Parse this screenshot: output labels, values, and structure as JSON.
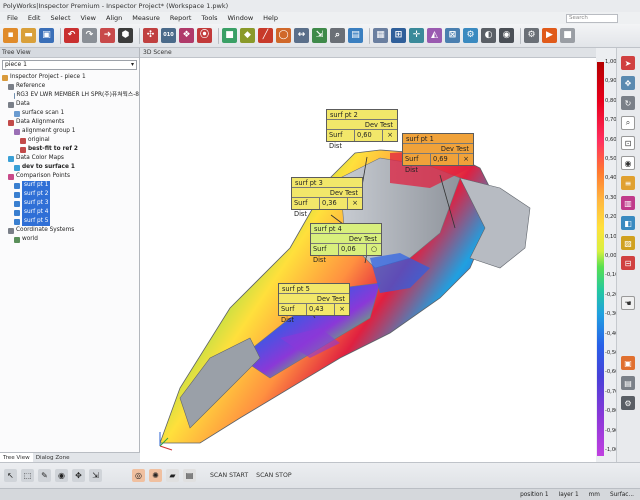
{
  "app": {
    "title": "PolyWorks|Inspector Premium - Inspector Project* (Workspace 1.pwk)"
  },
  "menu": [
    "File",
    "Edit",
    "Select",
    "View",
    "Align",
    "Measure",
    "Report",
    "Tools",
    "Window",
    "Help"
  ],
  "search": {
    "placeholder": "Search"
  },
  "toolbar": {
    "icons": [
      "new-project-icon",
      "open-folder-icon",
      "save-icon",
      "undo-icon",
      "redo-icon",
      "import-icon",
      "capture-icon",
      "points-icon",
      "binary-icon",
      "probe-icon",
      "align-icon",
      "cube-icon",
      "plane-icon",
      "line-icon",
      "circle-icon",
      "measure-icon",
      "probe-tip-icon",
      "zoom-icon",
      "display-icon",
      "table-icon",
      "feature-icon",
      "compass-icon",
      "gauge-icon",
      "report-icon",
      "gear-icon",
      "dial-icon",
      "camera-icon",
      "settings-icon",
      "play-icon",
      "stop-icon"
    ]
  },
  "tree": {
    "header": "Tree View",
    "piece": "piece 1",
    "nodes": [
      {
        "label": "Inspector Project - piece 1",
        "level": 0,
        "color": "#d99a3c"
      },
      {
        "label": "Reference",
        "level": 1,
        "color": "#7a7f88"
      },
      {
        "label": "RG3 EV LWR MEMBER LH SPR(주)퓨쳐웍스-8",
        "level": 2,
        "color": "#6f8fb0"
      },
      {
        "label": "Data",
        "level": 1,
        "color": "#7a7f88"
      },
      {
        "label": "surface scan 1",
        "level": 2,
        "color": "#6a9bd0"
      },
      {
        "label": "Data Alignments",
        "level": 1,
        "color": "#c24a4a"
      },
      {
        "label": "alignment group 1",
        "level": 2,
        "color": "#9a6fb5"
      },
      {
        "label": "original",
        "level": 3,
        "color": "#c24a4a"
      },
      {
        "label": "best-fit to ref 2",
        "level": 3,
        "color": "#c24a4a"
      },
      {
        "label": "Data Color Maps",
        "level": 1,
        "color": "#3aa0d6"
      },
      {
        "label": "dev to surface 1",
        "level": 2,
        "color": "#3aa0d6"
      },
      {
        "label": "Comparison Points",
        "level": 1,
        "color": "#c84a8a"
      },
      {
        "label": "surf pt 1",
        "level": 2,
        "color": "#3a7fd0"
      },
      {
        "label": "surf pt 2",
        "level": 2,
        "color": "#3a7fd0"
      },
      {
        "label": "surf pt 3",
        "level": 2,
        "color": "#3a7fd0"
      },
      {
        "label": "surf pt 4",
        "level": 2,
        "color": "#3a7fd0"
      },
      {
        "label": "surf pt 5",
        "level": 2,
        "color": "#3a7fd0"
      },
      {
        "label": "Coordinate Systems",
        "level": 1,
        "color": "#7a7f88"
      },
      {
        "label": "world",
        "level": 2,
        "color": "#5a8f5a"
      }
    ],
    "tabs": [
      "Tree View",
      "Dialog Zone"
    ]
  },
  "viewport": {
    "header": "3D Scene"
  },
  "callouts": [
    {
      "name": "surf pt 2",
      "col_label": "Dev Test",
      "row_label": "Surf Dist",
      "value": "0,60",
      "status": "×",
      "color": "yellow"
    },
    {
      "name": "surf pt 1",
      "col_label": "Dev Test",
      "row_label": "Surf Dist",
      "value": "0,69",
      "status": "×",
      "color": "orange"
    },
    {
      "name": "surf pt 3",
      "col_label": "Dev Test",
      "row_label": "Surf Dist",
      "value": "0,36",
      "status": "×",
      "color": "yellow"
    },
    {
      "name": "surf pt 4",
      "col_label": "Dev Test",
      "row_label": "Surf Dist",
      "value": "0,06",
      "status": "○",
      "color": "green"
    },
    {
      "name": "surf pt 5",
      "col_label": "Dev Test",
      "row_label": "Surf Dist",
      "value": "0,43",
      "status": "×",
      "color": "yellow"
    }
  ],
  "scale": {
    "ticks": [
      "1,00",
      "0,90",
      "0,80",
      "0,70",
      "0,60",
      "0,50",
      "0,40",
      "0,30",
      "0,20",
      "0,10",
      "0,00",
      "-0,10",
      "-0,20",
      "-0,30",
      "-0,40",
      "-0,50",
      "-0,60",
      "-0,70",
      "-0,80",
      "-0,90",
      "-1,00"
    ]
  },
  "right_tools": {
    "icons": [
      "arrow-icon",
      "pan-icon",
      "rotate-icon",
      "zoom-icon",
      "fit-icon",
      "visibility-icon",
      "layers-icon",
      "color-map-icon",
      "clip-icon",
      "section-icon",
      "label-icon",
      "hand-icon",
      "clipboard-icon",
      "report-icon",
      "settings-icon"
    ]
  },
  "bottom": {
    "scan_start": "SCAN START",
    "scan_stop": "SCAN STOP"
  },
  "status": {
    "position": "position 1",
    "layer": "layer 1",
    "units": "mm",
    "mode": "Surfac..."
  },
  "colors": {
    "accent": "#2f6fd6",
    "callout_yellow": "#f2e76a",
    "callout_orange": "#f0a23a",
    "callout_green": "#d8ef7d"
  }
}
